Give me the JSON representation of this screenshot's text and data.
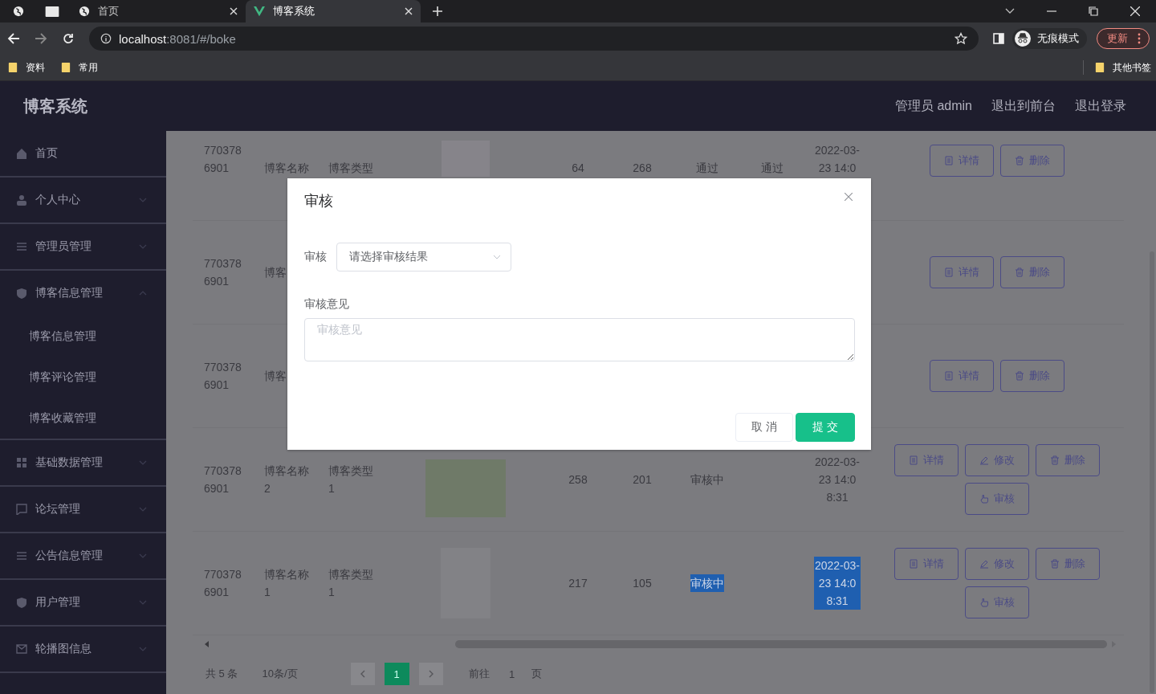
{
  "browser": {
    "tabs": [
      {
        "title": "首页",
        "kind": "globe",
        "selected": false
      },
      {
        "title": "博客系统",
        "kind": "vue",
        "selected": true
      }
    ],
    "address": {
      "host": "localhost",
      "path": ":8081/#/boke"
    },
    "profile": "无痕模式",
    "update_button": "更新",
    "bookmarks": [
      {
        "label": "资料"
      },
      {
        "label": "常用"
      }
    ],
    "other_bookmarks": "其他书签"
  },
  "app": {
    "title": "博客系统",
    "header_links": [
      "管理员 admin",
      "退出到前台",
      "退出登录"
    ]
  },
  "sidebar": {
    "items": [
      {
        "label": "首页"
      },
      {
        "label": "个人中心",
        "expanded": false
      },
      {
        "label": "管理员管理",
        "expanded": false
      },
      {
        "label": "博客信息管理",
        "expanded": true,
        "children": [
          {
            "label": "博客信息管理"
          },
          {
            "label": "博客评论管理"
          },
          {
            "label": "博客收藏管理"
          }
        ]
      },
      {
        "label": "基础数据管理",
        "expanded": false
      },
      {
        "label": "论坛管理",
        "expanded": false
      },
      {
        "label": "公告信息管理",
        "expanded": false
      },
      {
        "label": "用户管理",
        "expanded": false
      },
      {
        "label": "轮播图信息",
        "expanded": false
      }
    ]
  },
  "table": {
    "rows": [
      {
        "column_1": "7703786901",
        "column_2": "博客名称",
        "column_3": "博客类型",
        "image": true,
        "column_5": "64",
        "column_6": "268",
        "column_7": "通过",
        "column_8": "通过",
        "column_9": "2022-03-23 14:0",
        "actions": [
          {
            "label": "详情",
            "kind": "detail"
          },
          {
            "label": "删除",
            "kind": "delete"
          }
        ]
      },
      {
        "column_1": "7703786901",
        "column_2": "博客",
        "actions": [
          {
            "label": "详情",
            "kind": "detail"
          },
          {
            "label": "删除",
            "kind": "delete"
          }
        ]
      },
      {
        "column_1": "7703786901",
        "column_2": "博客",
        "actions": [
          {
            "label": "详情",
            "kind": "detail"
          },
          {
            "label": "删除",
            "kind": "delete"
          }
        ]
      },
      {
        "column_1": "7703786901",
        "column_2": "博客名称2",
        "column_3": "博客类型1",
        "image": true,
        "column_5": "258",
        "column_6": "201",
        "column_7": "审核中",
        "column_9": "2022-03-23 14:08:31",
        "actions": [
          {
            "label": "详情",
            "kind": "detail"
          },
          {
            "label": "修改",
            "kind": "edit"
          },
          {
            "label": "删除",
            "kind": "delete"
          },
          {
            "label": "审核",
            "kind": "review"
          }
        ]
      },
      {
        "column_1": "7703786901",
        "column_2": "博客名称1",
        "column_3": "博客类型1",
        "image": true,
        "column_5": "217",
        "column_6": "105",
        "column_7": "审核中",
        "column_9": "2022-03-23 14:08:31",
        "text_selected": true,
        "actions": [
          {
            "label": "详情",
            "kind": "detail"
          },
          {
            "label": "修改",
            "kind": "edit"
          },
          {
            "label": "删除",
            "kind": "delete"
          },
          {
            "label": "审核",
            "kind": "review"
          }
        ]
      }
    ]
  },
  "pagination": {
    "total": "共 5 条",
    "page_size": "10条/页",
    "pages": [
      {
        "label": "1",
        "selected": true
      }
    ],
    "goto_label": "前往",
    "goto_value": "1",
    "page_suffix": "页"
  },
  "dialog": {
    "title": "审核",
    "fields": [
      {
        "label": "审核",
        "kind": "select",
        "placeholder": "请选择审核结果"
      },
      {
        "label": "审核意见",
        "kind": "textarea",
        "placeholder": "审核意见"
      }
    ],
    "buttons": [
      {
        "label": "取 消",
        "kind": "secondary"
      },
      {
        "label": "提 交",
        "kind": "primary"
      }
    ]
  }
}
